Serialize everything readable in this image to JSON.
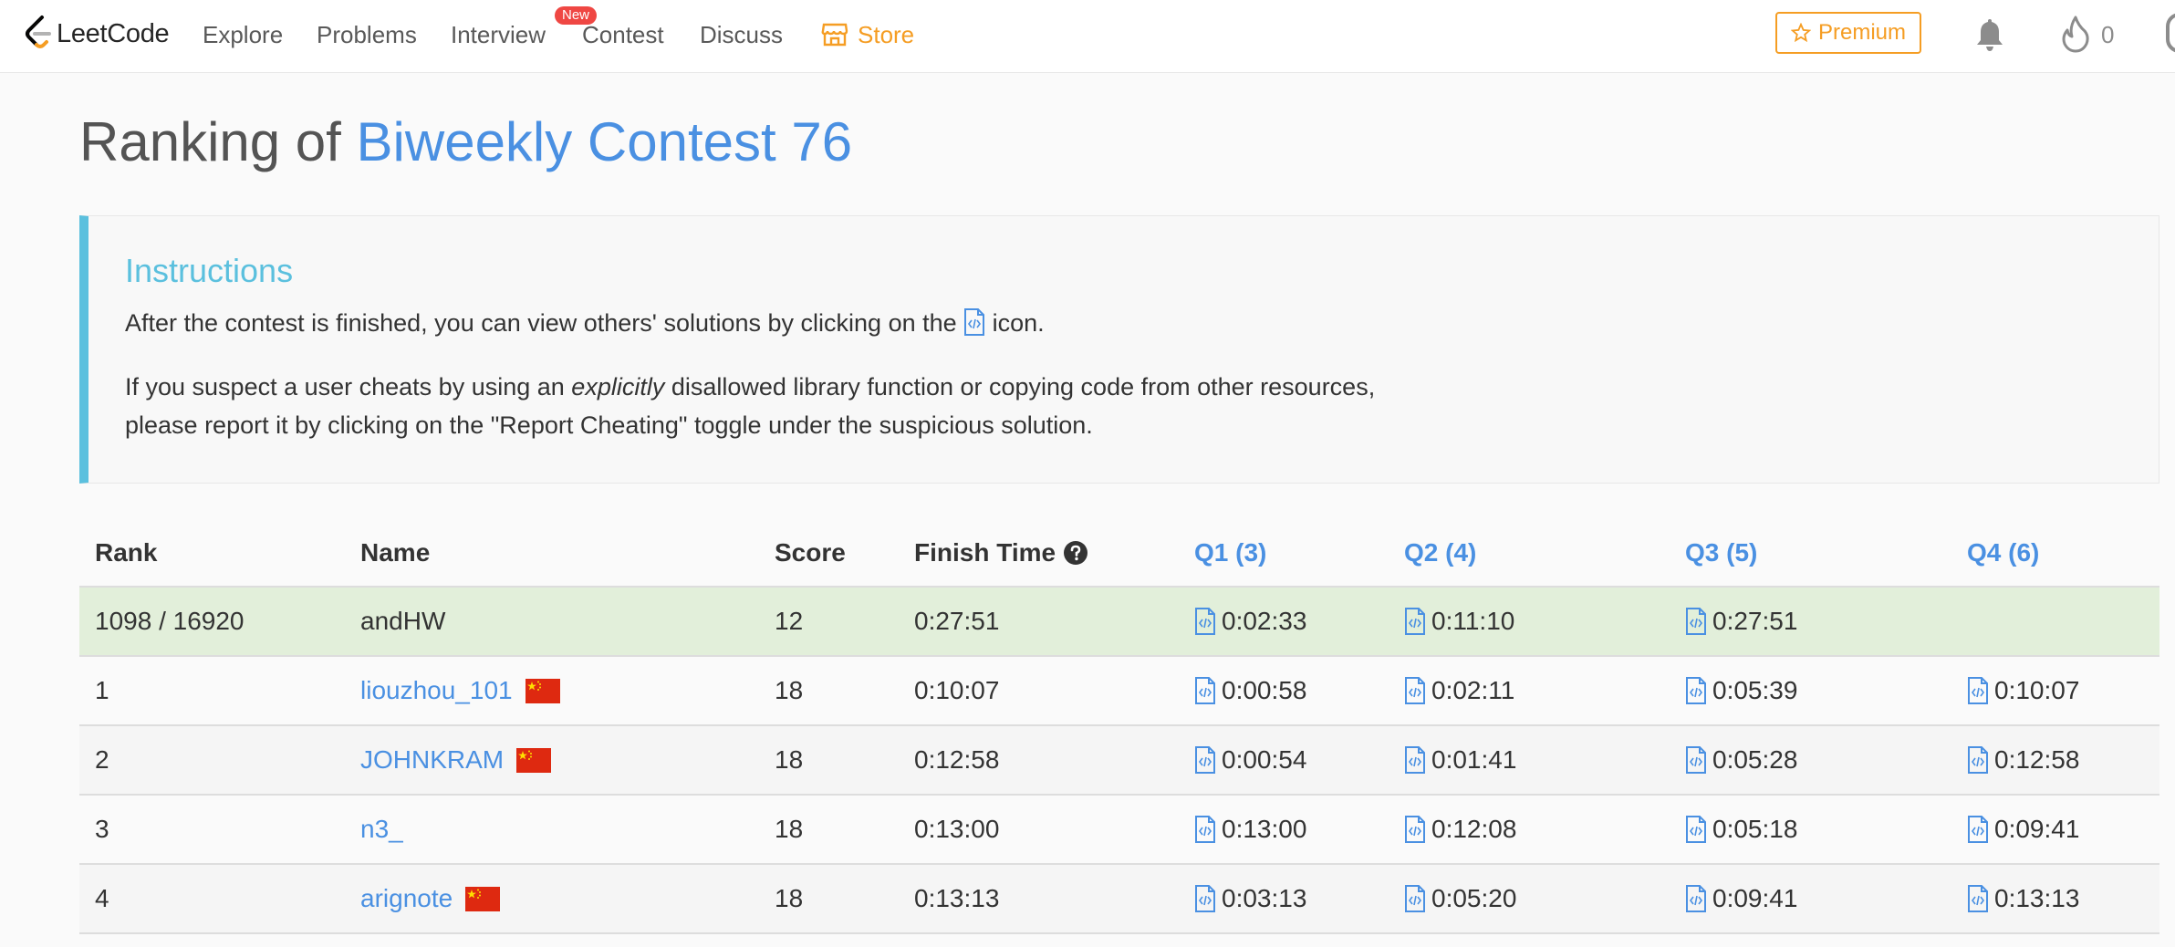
{
  "nav": {
    "logo_text": "LeetCode",
    "links": [
      "Explore",
      "Problems",
      "Interview",
      "Contest",
      "Discuss"
    ],
    "new_badge": "New",
    "store": "Store",
    "premium": "Premium",
    "fire_count": "0"
  },
  "title": {
    "prefix": "Ranking of ",
    "contest": "Biweekly Contest 76"
  },
  "instructions": {
    "title": "Instructions",
    "line1_before": "After the contest is finished, you can view others' solutions by clicking on the ",
    "line1_after": " icon.",
    "line2_before": "If you suspect a user cheats by using an ",
    "line2_em": "explicitly",
    "line2_after": " disallowed library function or copying code from other resources,",
    "line3": "please report it by clicking on the \"Report Cheating\" toggle under the suspicious solution."
  },
  "table": {
    "headers": {
      "rank": "Rank",
      "name": "Name",
      "score": "Score",
      "finish": "Finish Time",
      "q1": "Q1 (3)",
      "q2": "Q2 (4)",
      "q3": "Q3 (5)",
      "q4": "Q4 (6)"
    },
    "my_row": {
      "rank": "1098 / 16920",
      "name": "andHW",
      "score": "12",
      "finish": "0:27:51",
      "q1": "0:02:33",
      "q2": "0:11:10",
      "q3": "0:27:51",
      "q4": ""
    },
    "rows": [
      {
        "rank": "1",
        "name": "liouzhou_101",
        "flag": true,
        "score": "18",
        "finish": "0:10:07",
        "q1": "0:00:58",
        "q2": "0:02:11",
        "q3": "0:05:39",
        "q4": "0:10:07"
      },
      {
        "rank": "2",
        "name": "JOHNKRAM",
        "flag": true,
        "score": "18",
        "finish": "0:12:58",
        "q1": "0:00:54",
        "q2": "0:01:41",
        "q3": "0:05:28",
        "q4": "0:12:58"
      },
      {
        "rank": "3",
        "name": "n3_",
        "flag": false,
        "score": "18",
        "finish": "0:13:00",
        "q1": "0:13:00",
        "q2": "0:12:08",
        "q3": "0:05:18",
        "q4": "0:09:41"
      },
      {
        "rank": "4",
        "name": "arignote",
        "flag": true,
        "score": "18",
        "finish": "0:13:13",
        "q1": "0:03:13",
        "q2": "0:05:20",
        "q3": "0:09:41",
        "q4": "0:13:13"
      }
    ]
  },
  "colors": {
    "accent": "#4a90e2",
    "store": "#f59d23",
    "info": "#5bc0de",
    "my_row_bg": "#e2efda"
  }
}
